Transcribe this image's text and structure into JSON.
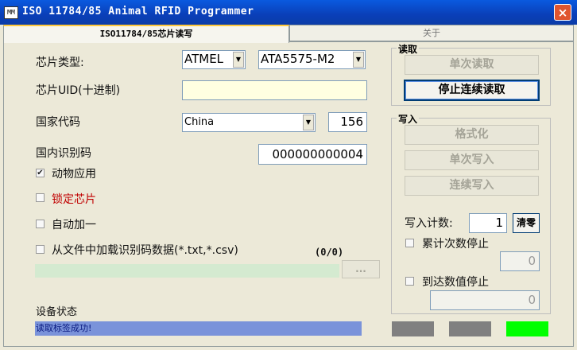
{
  "window": {
    "title": "ISO 11784/85 Animal RFID Programmer",
    "icon_text": "MM",
    "close_label": "×"
  },
  "tabs": [
    {
      "label": "ISO11784/85芯片读写"
    },
    {
      "label": "关于"
    }
  ],
  "left": {
    "chip_type_label": "芯片类型:",
    "chip_vendor": "ATMEL",
    "chip_model": "ATA5575-M2",
    "uid_label": "芯片UID(十进制)",
    "uid_value": "",
    "country_label": "国家代码",
    "country_name": "China",
    "country_code": "156",
    "national_id_label": "国内识别码",
    "national_id_value": "000000000004",
    "animal_app_label": "动物应用",
    "animal_app_checked": true,
    "lock_chip_label": "锁定芯片",
    "lock_chip_checked": false,
    "auto_increment_label": "自动加一",
    "auto_increment_checked": false,
    "load_file_label": "从文件中加载识别码数据(*.txt,*.csv)",
    "load_file_checked": false,
    "file_count": "(0/0)",
    "browse_label": "...",
    "device_status_label": "设备状态",
    "status_message": "读取标签成功!"
  },
  "read_group": {
    "title": "读取",
    "single_read": "单次读取",
    "stop_continuous_read": "停止连续读取"
  },
  "write_group": {
    "title": "写入",
    "format": "格式化",
    "single_write": "单次写入",
    "continuous_write": "连续写入",
    "write_count_label": "写入计数:",
    "write_count_value": "1",
    "clear_label": "清零",
    "accumulate_stop_label": "累计次数停止",
    "accumulate_value": "0",
    "reach_value_stop_label": "到达数值停止",
    "reach_value": "0"
  },
  "indicators": [
    {
      "name": "indicator-1",
      "color": "#808080"
    },
    {
      "name": "indicator-2",
      "color": "#808080"
    },
    {
      "name": "indicator-3",
      "color": "#00ff00"
    }
  ],
  "colors": {
    "title_bar": "#0a4fd0",
    "lock_chip_text": "#c00000",
    "status_bar": "#7a93da"
  }
}
